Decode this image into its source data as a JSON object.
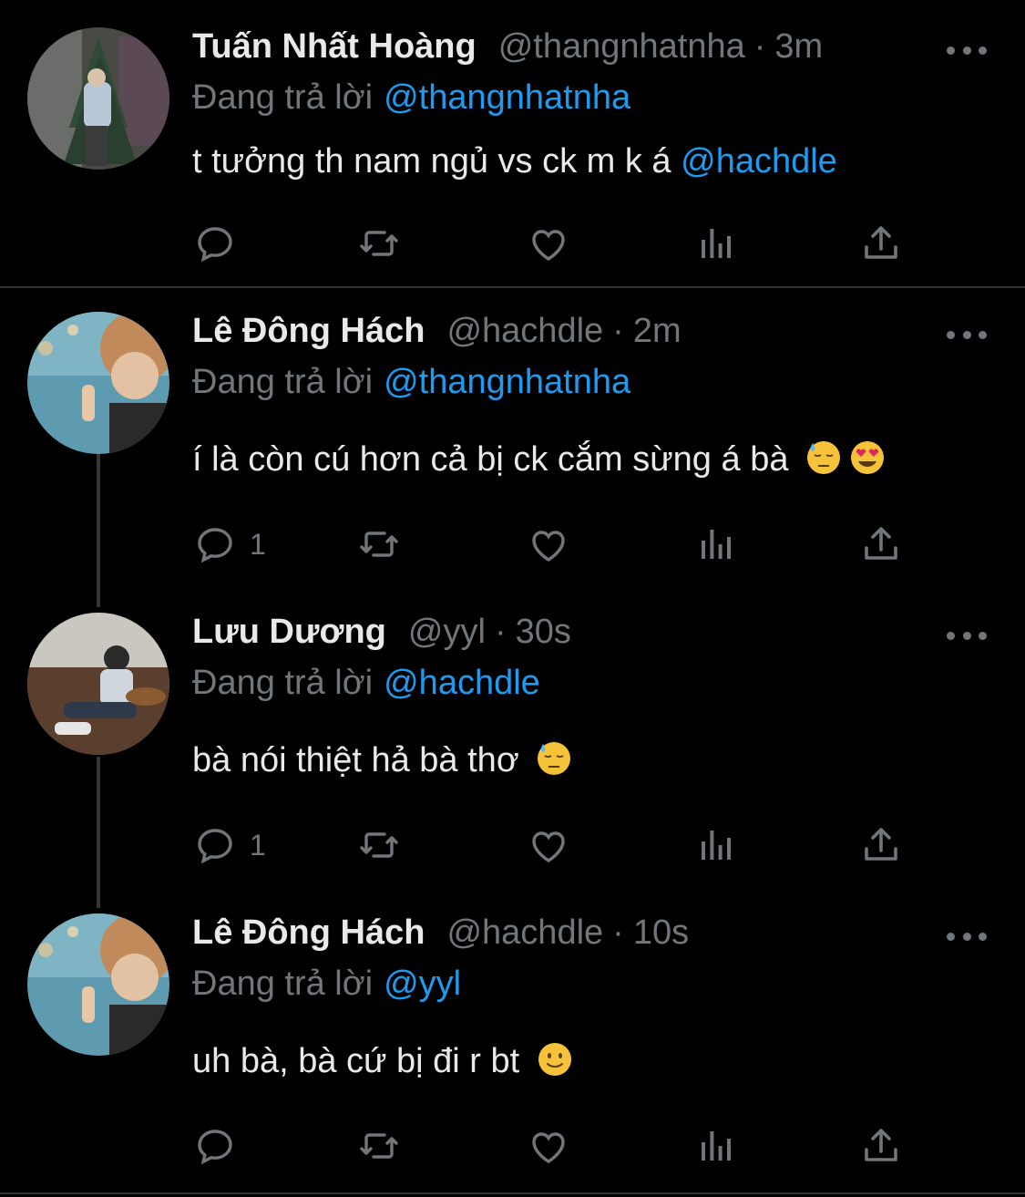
{
  "reply_prefix": "Đang trả lời",
  "tweets": [
    {
      "name": "Tuấn Nhất Hoàng",
      "handle": "@thangnhatnha",
      "separator": "·",
      "time": "3m",
      "reply_to": "@thangnhatnha",
      "text": "t tưởng th nam ngủ vs ck m k á ",
      "text_mention": "@hachdle",
      "emojis": [],
      "reply_count": ""
    },
    {
      "name": "Lê Đông Hách",
      "handle": "@hachdle",
      "separator": "·",
      "time": "2m",
      "reply_to": "@thangnhatnha",
      "text": "í là còn cú hơn cả bị ck cắm sừng á bà",
      "text_mention": "",
      "emojis": [
        "downcast-sweat-emoji",
        "heart-eyes-emoji"
      ],
      "reply_count": "1"
    },
    {
      "name": "Lưu Dương",
      "handle": "@yyl",
      "separator": "·",
      "time": "30s",
      "reply_to": "@hachdle",
      "text": "bà nói thiệt hả bà thơ",
      "text_mention": "",
      "emojis": [
        "downcast-sweat-emoji"
      ],
      "reply_count": "1"
    },
    {
      "name": "Lê Đông Hách",
      "handle": "@hachdle",
      "separator": "·",
      "time": "10s",
      "reply_to": "@yyl",
      "text": "uh bà, bà cứ bị đi r bt",
      "text_mention": "",
      "emojis": [
        "slight-smile-emoji"
      ],
      "reply_count": ""
    }
  ],
  "icons": {
    "reply": "reply-icon",
    "retweet": "retweet-icon",
    "like": "heart-icon",
    "views": "views-icon",
    "share": "share-icon",
    "more": "more-icon"
  },
  "colors": {
    "background": "#000000",
    "text": "#e7e9ea",
    "secondary": "#71767b",
    "accent": "#1d9bf0",
    "divider": "#2f3336"
  }
}
